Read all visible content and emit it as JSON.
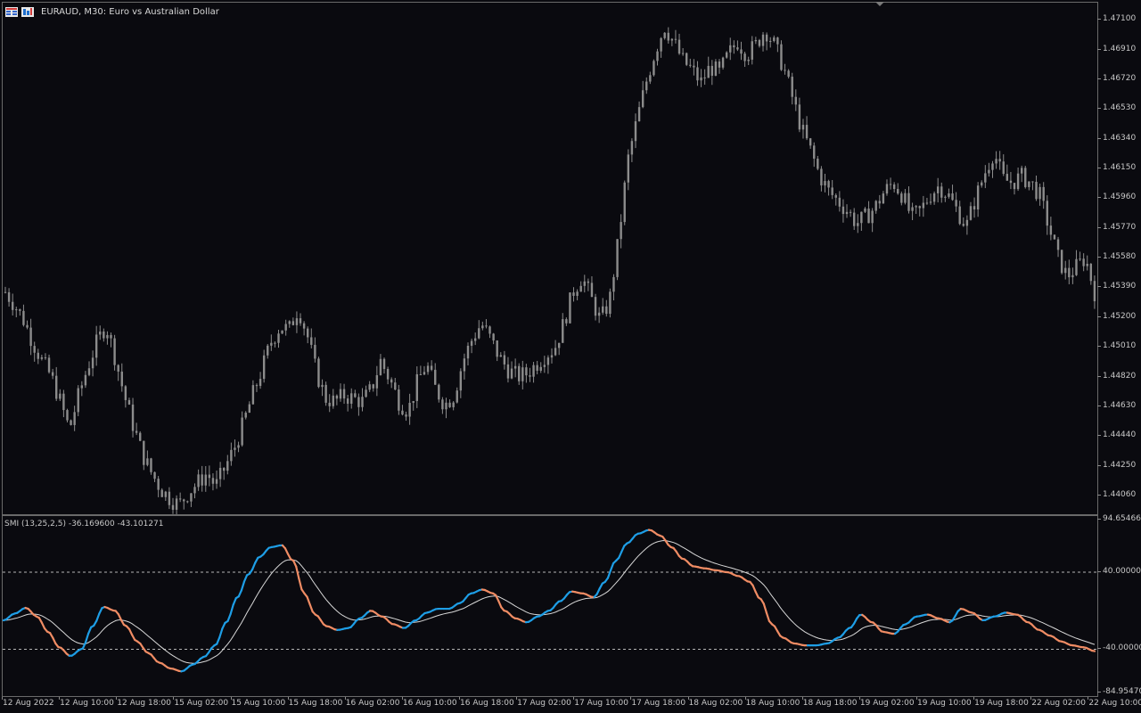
{
  "chart": {
    "title": "EURAUD, M30:  Euro vs Australian Dollar",
    "icons": [
      "calendar-grid-icon",
      "one-click-trading-icon"
    ]
  },
  "colors": {
    "background": "#0a0a0f",
    "candle": "#8c8c8c",
    "smi_up": "#1e9ee6",
    "smi_down": "#f08c64",
    "signal": "#d8d8d8",
    "level_line": "#b4b4b4",
    "grid_border": "#6a6a6a"
  },
  "indicator": {
    "label": "SMI (13,25,2,5) -36.169600 -43.101271"
  },
  "price_scale": [
    "1.47100",
    "1.46910",
    "1.46720",
    "1.46530",
    "1.46340",
    "1.46150",
    "1.45960",
    "1.45770",
    "1.45580",
    "1.45390",
    "1.45200",
    "1.45010",
    "1.44820",
    "1.44630",
    "1.44440",
    "1.44250",
    "1.44060"
  ],
  "indicator_scale": [
    "94.654663",
    "40.000000",
    "-40.000000",
    "-84.954700"
  ],
  "time_axis": [
    "12 Aug 2022",
    "12 Aug 10:00",
    "12 Aug 18:00",
    "15 Aug 02:00",
    "15 Aug 10:00",
    "15 Aug 18:00",
    "16 Aug 02:00",
    "16 Aug 10:00",
    "16 Aug 18:00",
    "17 Aug 02:00",
    "17 Aug 10:00",
    "17 Aug 18:00",
    "18 Aug 02:00",
    "18 Aug 10:00",
    "18 Aug 18:00",
    "19 Aug 02:00",
    "19 Aug 10:00",
    "19 Aug 18:00",
    "22 Aug 02:00",
    "22 Aug 10:00"
  ],
  "chart_data": [
    {
      "type": "candlestick",
      "title": "EURAUD, M30:  Euro vs Australian Dollar",
      "ylim": [
        1.4394,
        1.4721
      ],
      "close_path": [
        1.4536,
        1.4528,
        1.4518,
        1.4504,
        1.4492,
        1.4482,
        1.4466,
        1.4448,
        1.447,
        1.4488,
        1.4504,
        1.4515,
        1.4494,
        1.447,
        1.445,
        1.4432,
        1.442,
        1.441,
        1.4404,
        1.44,
        1.4408,
        1.4414,
        1.442,
        1.4412,
        1.4424,
        1.4436,
        1.4452,
        1.447,
        1.4486,
        1.4504,
        1.4514,
        1.4512,
        1.4526,
        1.4508,
        1.4484,
        1.4468,
        1.4466,
        1.447,
        1.4468,
        1.4466,
        1.4474,
        1.4492,
        1.448,
        1.4466,
        1.446,
        1.4478,
        1.449,
        1.4474,
        1.4464,
        1.447,
        1.4492,
        1.4506,
        1.4516,
        1.4506,
        1.4494,
        1.4486,
        1.4482,
        1.4484,
        1.449,
        1.4496,
        1.45,
        1.4516,
        1.4536,
        1.4546,
        1.4532,
        1.4518,
        1.453,
        1.457,
        1.462,
        1.4646,
        1.467,
        1.469,
        1.4706,
        1.4696,
        1.4684,
        1.4678,
        1.467,
        1.468,
        1.4676,
        1.4688,
        1.4696,
        1.4688,
        1.4694,
        1.4704,
        1.4694,
        1.468,
        1.466,
        1.464,
        1.4626,
        1.461,
        1.46,
        1.4594,
        1.4588,
        1.458,
        1.4584,
        1.459,
        1.46,
        1.4606,
        1.4598,
        1.4584,
        1.4588,
        1.4598,
        1.4604,
        1.4598,
        1.4588,
        1.4578,
        1.4596,
        1.4612,
        1.4626,
        1.4608,
        1.4606,
        1.461,
        1.4606,
        1.4598,
        1.4578,
        1.4558,
        1.4546,
        1.4552,
        1.4558,
        1.4536
      ],
      "price_scale_ticks": [
        1.471,
        1.4691,
        1.4672,
        1.4653,
        1.4634,
        1.4615,
        1.4596,
        1.4577,
        1.4558,
        1.4539,
        1.452,
        1.4501,
        1.4482,
        1.4463,
        1.4444,
        1.4425,
        1.4406
      ]
    },
    {
      "type": "line",
      "title": "SMI (13,25,2,5)",
      "ylim": [
        -84.9547,
        94.654663
      ],
      "levels": [
        40,
        -40
      ],
      "last_values": {
        "smi": -36.1696,
        "signal": -43.101271
      },
      "smi_path": [
        -10,
        -3,
        3,
        -6,
        -22,
        -38,
        -47,
        -40,
        -16,
        4,
        0,
        -16,
        -32,
        -44,
        -54,
        -60,
        -63,
        -56,
        -48,
        -36,
        -12,
        14,
        38,
        56,
        66,
        68,
        52,
        18,
        -4,
        -16,
        -20,
        -18,
        -8,
        0,
        -6,
        -14,
        -18,
        -10,
        -2,
        2,
        2,
        8,
        18,
        22,
        18,
        0,
        -8,
        -12,
        -6,
        0,
        10,
        20,
        18,
        14,
        30,
        52,
        70,
        80,
        84,
        78,
        66,
        54,
        46,
        44,
        42,
        40,
        36,
        30,
        12,
        -14,
        -28,
        -34,
        -36,
        -36,
        -34,
        -28,
        -18,
        -4,
        -12,
        -22,
        -24,
        -14,
        -6,
        -4,
        -8,
        -12,
        2,
        -2,
        -10,
        -6,
        -2,
        -4,
        -12,
        -20,
        -26,
        -32,
        -36,
        -38,
        -42
      ],
      "series": [
        {
          "name": "SMI"
        },
        {
          "name": "Signal"
        }
      ]
    }
  ]
}
